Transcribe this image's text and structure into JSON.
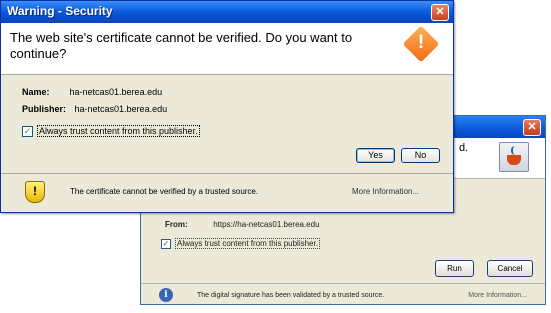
{
  "front": {
    "title": "Warning - Security",
    "close": "✕",
    "heading": "The web site's certificate cannot be verified.  Do you want to continue?",
    "warning_icon": "warning-diamond-icon",
    "name_label": "Name:",
    "name_value": "ha-netcas01.berea.edu",
    "publisher_label": "Publisher:",
    "publisher_value": "ha-netcas01.berea.edu",
    "checkbox_label": "Always trust content from this publisher.",
    "checkbox_checked": true,
    "yes_label": "Yes",
    "no_label": "No",
    "footer_icon": "shield-warning-icon",
    "footer_text": "The certificate cannot be verified by a trusted source.",
    "more_info": "More Information..."
  },
  "back": {
    "close": "✕",
    "head_text": "d.",
    "logo_icon": "java-icon",
    "from_label": "From:",
    "from_value": "https://ha-netcas01.berea.edu",
    "checkbox_label": "Always trust content from this publisher.",
    "checkbox_checked": true,
    "run_label": "Run",
    "cancel_label": "Cancel",
    "footer_icon": "info-shield-icon",
    "footer_text": "The digital signature has been validated by a trusted source.",
    "more_info": "More Information..."
  },
  "colors": {
    "titlebar": "#0c5fde",
    "dialog_bg": "#ece9d8",
    "warning_orange": "#f06a14"
  }
}
